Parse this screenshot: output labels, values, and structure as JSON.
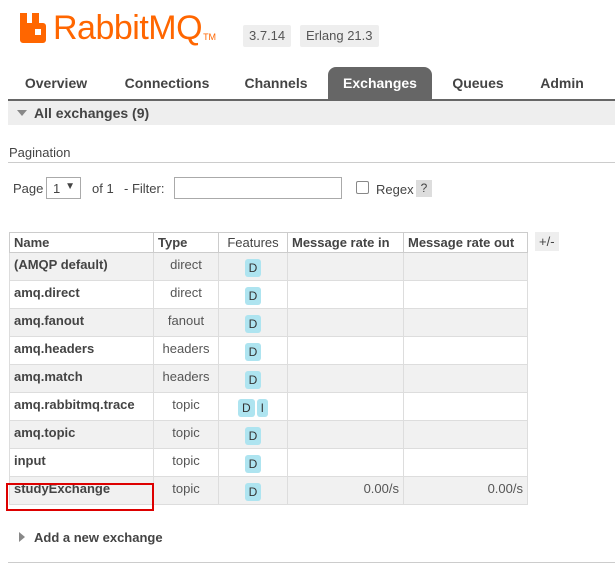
{
  "header": {
    "logo_text": "RabbitMQ",
    "logo_tm": "TM",
    "rabbitmq_version": "3.7.14",
    "erlang_version": "Erlang 21.3",
    "brand_color": "#ff6600"
  },
  "tabs": [
    {
      "label": "Overview",
      "active": false
    },
    {
      "label": "Connections",
      "active": false
    },
    {
      "label": "Channels",
      "active": false
    },
    {
      "label": "Exchanges",
      "active": true
    },
    {
      "label": "Queues",
      "active": false
    },
    {
      "label": "Admin",
      "active": false
    }
  ],
  "section": {
    "title": "All exchanges (9)"
  },
  "pagination": {
    "title": "Pagination",
    "page_label": "Page",
    "page_value": "1",
    "of_label": "of 1",
    "filter_label": "- Filter:",
    "filter_value": "",
    "regex_label": "Regex",
    "help_label": "?"
  },
  "table": {
    "columns": [
      "Name",
      "Type",
      "Features",
      "Message rate in",
      "Message rate out"
    ],
    "toggle_label": "+/-",
    "rows": [
      {
        "name": "(AMQP default)",
        "type": "direct",
        "features": [
          "D"
        ],
        "rate_in": "",
        "rate_out": ""
      },
      {
        "name": "amq.direct",
        "type": "direct",
        "features": [
          "D"
        ],
        "rate_in": "",
        "rate_out": ""
      },
      {
        "name": "amq.fanout",
        "type": "fanout",
        "features": [
          "D"
        ],
        "rate_in": "",
        "rate_out": ""
      },
      {
        "name": "amq.headers",
        "type": "headers",
        "features": [
          "D"
        ],
        "rate_in": "",
        "rate_out": ""
      },
      {
        "name": "amq.match",
        "type": "headers",
        "features": [
          "D"
        ],
        "rate_in": "",
        "rate_out": ""
      },
      {
        "name": "amq.rabbitmq.trace",
        "type": "topic",
        "features": [
          "D",
          "I"
        ],
        "rate_in": "",
        "rate_out": ""
      },
      {
        "name": "amq.topic",
        "type": "topic",
        "features": [
          "D"
        ],
        "rate_in": "",
        "rate_out": ""
      },
      {
        "name": "input",
        "type": "topic",
        "features": [
          "D"
        ],
        "rate_in": "",
        "rate_out": ""
      },
      {
        "name": "studyExchange",
        "type": "topic",
        "features": [
          "D"
        ],
        "rate_in": "0.00/s",
        "rate_out": "0.00/s"
      }
    ],
    "highlighted_row": "studyExchange"
  },
  "add_exchange": {
    "label": "Add a new exchange"
  }
}
